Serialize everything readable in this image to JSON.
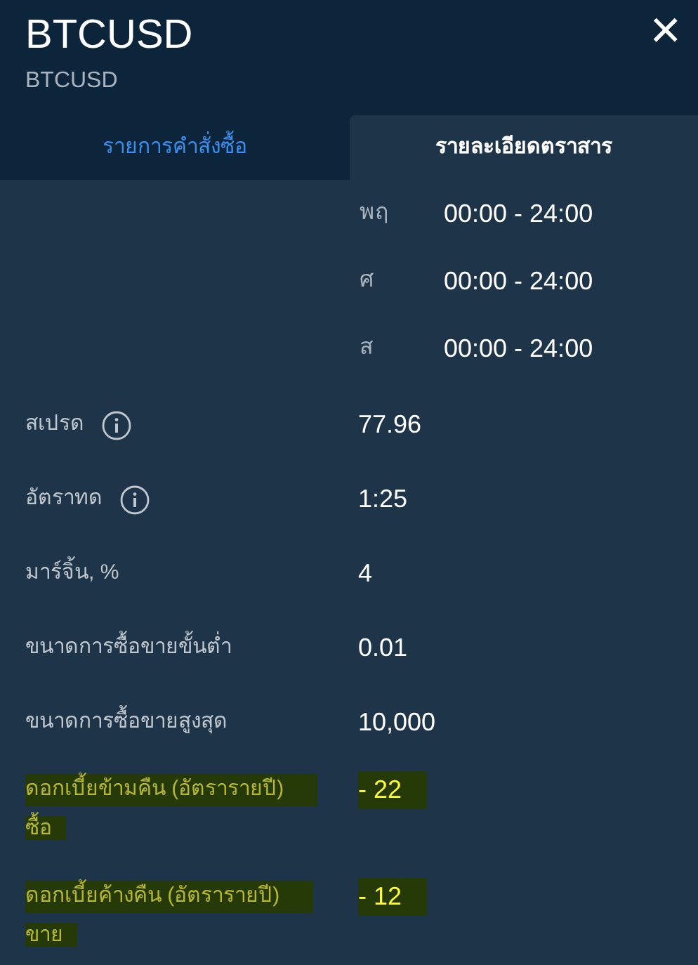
{
  "header": {
    "title": "BTCUSD",
    "subtitle": "BTCUSD",
    "close_icon": "×"
  },
  "tabs": [
    {
      "label": "รายการคำสั่งซื้อ",
      "selected": false
    },
    {
      "label": "รายละเอียดตราสาร",
      "selected": true
    }
  ],
  "schedule": [
    {
      "day": "พฤ",
      "hours": "00:00 - 24:00"
    },
    {
      "day": "ศ",
      "hours": "00:00 - 24:00"
    },
    {
      "day": "ส",
      "hours": "00:00 - 24:00"
    }
  ],
  "details": [
    {
      "label": "สเปรด",
      "info": true,
      "value": "77.96",
      "highlighted": false
    },
    {
      "label": "อัตราทด",
      "info": true,
      "value": "1:25",
      "highlighted": false
    },
    {
      "label": "มาร์จิ้น, %",
      "info": false,
      "value": "4",
      "highlighted": false
    },
    {
      "label": "ขนาดการซื้อขายขั้นต่ำ",
      "info": false,
      "value": "0.01",
      "highlighted": false
    },
    {
      "label": "ขนาดการซื้อขายสูงสุด",
      "info": false,
      "value": "10,000",
      "highlighted": false
    },
    {
      "label": "ดอกเบี้ยข้ามคืน (อัตรารายปี)",
      "sublabel": "ซื้อ",
      "info": false,
      "value": "- 22",
      "highlighted": true
    },
    {
      "label": "ดอกเบี้ยค้างคืน (อัตรารายปี)",
      "sublabel": "ขาย",
      "info": false,
      "value": "- 12",
      "highlighted": true
    }
  ]
}
